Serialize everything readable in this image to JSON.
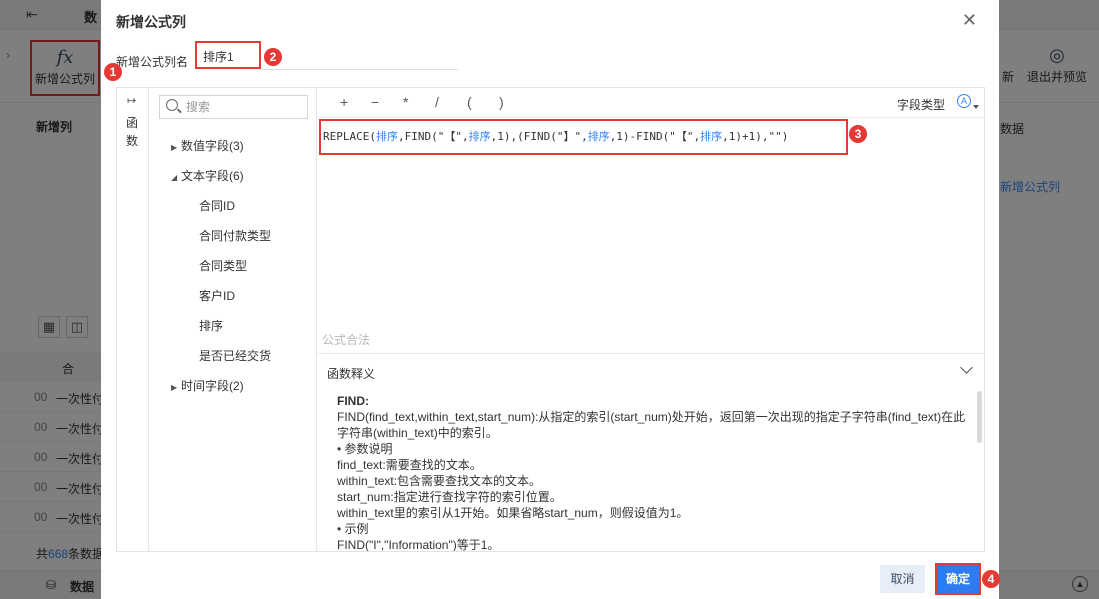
{
  "background": {
    "topbar_title": "数",
    "toolbar": {
      "formula_button": "新增公式列",
      "new_right": "新",
      "exit_preview": "退出并预览"
    },
    "side_label": "新增列",
    "right_panel": {
      "item1": "数据",
      "item2": "新增公式列"
    },
    "table": {
      "header": "合",
      "rows": [
        {
          "n": "00",
          "text": "一次性付"
        },
        {
          "n": "00",
          "text": "一次性付"
        },
        {
          "n": "00",
          "text": "一次性付"
        },
        {
          "n": "00",
          "text": "一次性付"
        },
        {
          "n": "00",
          "text": "一次性付"
        }
      ]
    },
    "total": {
      "prefix": "共",
      "count": "668",
      "suffix": "条数据"
    },
    "bottom_label": "数据"
  },
  "dialog": {
    "title": "新增公式列",
    "name_label": "新增公式列名",
    "name_value": "排序1",
    "rail_label": "函数",
    "search_placeholder": "搜索",
    "tree": {
      "numeric": "数值字段(3)",
      "text": "文本字段(6)",
      "text_items": [
        "合同ID",
        "合同付款类型",
        "合同类型",
        "客户ID",
        "排序",
        "是否已经交货"
      ],
      "time": "时间字段(2)"
    },
    "operators": [
      "+",
      "−",
      "*",
      "/",
      "(",
      ")"
    ],
    "field_type_label": "字段类型",
    "formula": {
      "p1": "REPLACE(",
      "f1": "排序",
      "p2": ",FIND(\"【\",",
      "f2": "排序",
      "p3": ",1),(FIND(\"】\",",
      "f3": "排序",
      "p4": ",1)-FIND(\"【\",",
      "f4": "排序",
      "p5": ",1)+1),\"\")"
    },
    "formula_status": "公式合法",
    "explain_title": "函数释义",
    "explain": {
      "fname": "FIND:",
      "lines": [
        "FIND(find_text,within_text,start_num):从指定的索引(start_num)处开始，返回第一次出现的指定子字符串(find_text)在此字符串(within_text)中的索引。",
        "• 参数说明",
        "find_text:需要查找的文本。",
        "within_text:包含需要查找文本的文本。",
        "start_num:指定进行查找字符的索引位置。",
        "within_text里的索引从1开始。如果省略start_num，则假设值为1。",
        "• 示例",
        "FIND(\"I\",\"Information\")等于1。"
      ]
    },
    "cancel": "取消",
    "ok": "确定"
  },
  "badges": [
    "1",
    "2",
    "3",
    "4"
  ],
  "colors": {
    "accent": "#2e7bef",
    "highlight": "#e53935",
    "field": "#3685f2"
  }
}
